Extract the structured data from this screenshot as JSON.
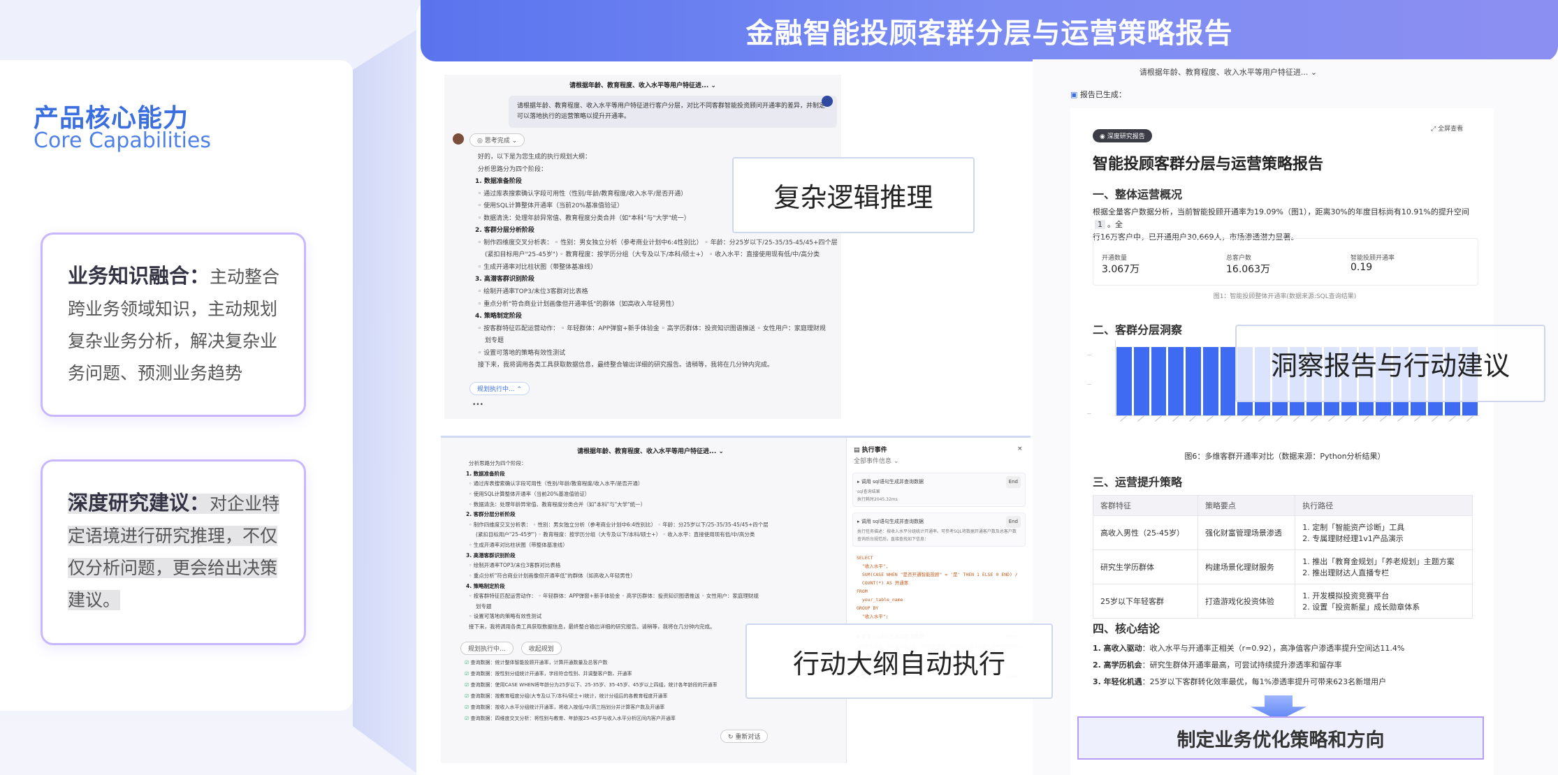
{
  "left": {
    "title": "产品核心能力",
    "subtitle": "Core Capabilities",
    "card1": {
      "heading": "业务知识融合：",
      "body": "主动整合跨业务领域知识，主动规划复杂业务分析，解决复杂业务问题、预测业务趋势"
    },
    "card2": {
      "heading": "深度研究建议：",
      "body": "对企业特定语境进行研究推理，不仅仅分析问题，更会给出决策建议。"
    }
  },
  "main_title": "金融智能投顾客群分层与运营策略报告",
  "callouts": {
    "reasoning": "复杂逻辑推理",
    "insight": "洞察报告与行动建议",
    "execution": "行动大纲自动执行",
    "bottom": "制定业务优化策略和方向"
  },
  "shot1": {
    "header": "请根据年龄、教育程度、收入水平等用户特征进...",
    "user_msg": "请根据年龄、教育程度、收入水平等用户特征进行客户分层，对比不同客群智能投资顾问开通率的差异，并制定可以落地执行的运营策略以提升开通率。",
    "thinking_pill": "思考完成",
    "lines": [
      {
        "t": "好的，以下是为您生成的执行规划大纲：",
        "s": "n"
      },
      {
        "t": "分析思路分为四个阶段：",
        "s": "n"
      },
      {
        "t": "1. 数据准备阶段",
        "s": "b"
      },
      {
        "t": "◦ 通过库表搜索确认字段可用性（性别/年龄/教育程度/收入水平/是否开通）",
        "s": "n"
      },
      {
        "t": "◦ 使用SQL计算整体开通率（当前20%基准值验证）",
        "s": "n"
      },
      {
        "t": "◦ 数据清洗：处理年龄异常值、教育程度分类合并（如\"本科\"与\"大学\"统一）",
        "s": "n"
      },
      {
        "t": "2. 客群分层分析阶段",
        "s": "b"
      },
      {
        "t": "◦ 制作四维度交叉分析表：  ◦ 性别：男女独立分析（参考商业计划中6:4性别比）  ◦ 年龄：分25岁以下/25-35/35-45/45+四个层",
        "s": "n"
      },
      {
        "t": "  (紧扣目标用户\"25-45岁\")  ◦ 教育程度：按学历分组（大专及以下/本科/硕士+）  ◦ 收入水平：直接使用现有低/中/高分类",
        "s": "n"
      },
      {
        "t": "◦ 生成开通率对比柱状图（带整体基准线）",
        "s": "n"
      },
      {
        "t": "3. 高潜客群识别阶段",
        "s": "b"
      },
      {
        "t": "◦ 绘制开通率TOP3/末位3客群对比表格",
        "s": "n"
      },
      {
        "t": "◦ 重点分析\"符合商业计划画像但开通率低\"的群体（如高收入年轻男性）",
        "s": "n"
      },
      {
        "t": "4. 策略制定阶段",
        "s": "b"
      },
      {
        "t": "◦ 按客群特征匹配运营动作：  ◦ 年轻群体：APP弹窗+新手体验金  ◦ 高学历群体：投资知识图谱推送  ◦ 女性用户：家庭理财规",
        "s": "n"
      },
      {
        "t": "  划专题",
        "s": "n"
      },
      {
        "t": "◦ 设置可落地的策略有效性测试",
        "s": "n"
      },
      {
        "t": "接下来，我将调用各类工具获取数据信息，最终整合输出详细的研究报告。请稍等，我将在几分钟内完成。",
        "s": "n"
      }
    ],
    "planning_pill": "规划执行中..."
  },
  "shot2": {
    "header": "请根据年龄、教育程度、收入水平等用户特征进...",
    "lines": [
      {
        "t": "分析思路分为四个阶段：",
        "s": "n"
      },
      {
        "t": "1. 数据准备阶段",
        "s": "b"
      },
      {
        "t": "◦ 通过库表搜索确认字段可用性（性别/年龄/教育程度/收入水平/是否开通）",
        "s": "n"
      },
      {
        "t": "◦ 使用SQL计算整体开通率（当前20%基准值验证）",
        "s": "n"
      },
      {
        "t": "◦ 数据清洗：处理年龄异常值、教育程度分类合并（如\"本科\"与\"大学\"统一）",
        "s": "n"
      },
      {
        "t": "2. 客群分层分析阶段",
        "s": "b"
      },
      {
        "t": "◦ 制作四维度交叉分析表：  ◦ 性别：男女独立分析（参考商业计划中6:4性别比）  ◦ 年龄：分25岁以下/25-35/35-45/45+四个层",
        "s": "n"
      },
      {
        "t": "  (紧扣目标用户\"25-45岁\")  ◦ 教育程度：按学历分组（大专及以下/本科/硕士+）  ◦ 收入水平：直接使用现有低/中/高分类",
        "s": "n"
      },
      {
        "t": "◦ 生成开通率对比柱状图（带整体基准线）",
        "s": "n"
      },
      {
        "t": "3. 高潜客群识别阶段",
        "s": "b"
      },
      {
        "t": "◦ 绘制开通率TOP3/末位3客群对比表格",
        "s": "n"
      },
      {
        "t": "◦ 重点分析\"符合商业计划画像但开通率低\"的群体（如高收入年轻男性）",
        "s": "n"
      },
      {
        "t": "4. 策略制定阶段",
        "s": "b"
      },
      {
        "t": "◦ 按客群特征匹配运营动作：  ◦ 年轻群体：APP弹窗+新手体验金  ◦ 高学历群体：投资知识图谱推送  ◦ 女性用户：家庭理财规",
        "s": "n"
      },
      {
        "t": "  划专题",
        "s": "n"
      },
      {
        "t": "◦ 设置可落地的策略有效性测试",
        "s": "n"
      },
      {
        "t": "接下来，我将调用各类工具获取数据信息，最终整合输出详细的研究报告。请稍等，我将在几分钟内完成。",
        "s": "n"
      }
    ],
    "pill_executing": "规划执行中...",
    "pill_collapse": "收起规划",
    "tasks": [
      "查询数据：统计整体智能投顾开通率，计算开通数量及总客户数",
      "查询数据：按性别分组统计开通率，字段符合性别、并调整客户数、开通率",
      "查询数据：使用CASE WHEN将年龄分为25岁以下、25-35岁、35-45岁、45岁以上四组，统计各年龄段的开通率",
      "查询数据：按教育程度分组(大专及以下/本科/硕士+)统计，统计分组后的各教育程度开通率",
      "查询数据：按收入水平分组统计开通率，将收入按低/中/高三档划分并计算客户数及开通率",
      "查询数据：四维度交叉分析：将性别与教育、年龄按25-45岁与收入水平分析区间内客户开通率"
    ],
    "retry": "重新对话",
    "events_title": "执行事件",
    "events_sub": "全部事件信息",
    "events": [
      {
        "label": "调用 sql语句生成并查询数据",
        "tag": "End",
        "a": "sql查询结果",
        "b": "执行耗时2045.32ms"
      },
      {
        "label": "调用 sql语句生成并查询数据",
        "tag": "End",
        "a": "执行任务描述：按收入水平分组统计开通率。可参考SQL将数据开通客户数及总客户数",
        "b": "查询后台规范后，直接查找如下信息："
      }
    ],
    "sql_lines": [
      "SELECT",
      "  \"收入水平\",",
      "  SUM(CASE WHEN \"是否开通智能投顾\" = '是' THEN 1 ELSE 0 END) /",
      "  COUNT(*) AS 开通率",
      "FROM",
      "  your_table_name",
      "GROUP BY",
      "  \"收入水平\";"
    ],
    "events_more": [
      {
        "label": "调用 sql语句生成并查询数据",
        "tag": "Start",
        "a": "执行任务描述：四维度交叉分析：将性别与教育、年龄按25-45岁与收入水平分析区间内客户开通率"
      },
      {
        "label": "调用 sql语句生成并查询数据",
        "tag": "Start"
      }
    ]
  },
  "shot3": {
    "header": "请根据年龄、教育程度、收入水平等用户特征进...",
    "generated": "报告已生成：",
    "tag": "深度研究报告",
    "fullscreen": "全屏查看",
    "title": "智能投顾客群分层与运营策略报告",
    "s1": "一、整体运营概况",
    "s1_text1": "根据全量客户数据分析，当前智能投顾开通率为19.09%（图1），距离30%的年度目标尚有10.91%的提升空间",
    "s1_ref": "1",
    "s1_text1b": "。全",
    "s1_text2": "行16万客户中，已开通用户30,669人，市场渗透潜力显著。",
    "stats": [
      {
        "label": "开通数量",
        "value": "3.067万"
      },
      {
        "label": "总客户数",
        "value": "16.063万"
      },
      {
        "label": "智能投顾开通率",
        "value": "0.19"
      }
    ],
    "fig1": "图1：智能投顾整体开通率(数据来源:SQL查询结果)",
    "s2": "二、客群分层洞察",
    "fig6": "图6：多维客群开通率对比（数据来源：Python分析结果）",
    "s3": "三、运营提升策略",
    "table_head": [
      "客群特征",
      "策略要点",
      "执行路径"
    ],
    "table_rows": [
      [
        "高收入男性（25-45岁）",
        "强化财富管理场景渗透",
        "1. 定制「智能资产诊断」工具",
        "2. 专属理财经理1v1产品演示"
      ],
      [
        "研究生学历群体",
        "构建场景化理财服务",
        "1. 推出「教育金规划」「养老规划」主题方案",
        "2. 推出理财达人直播专栏"
      ],
      [
        "25岁以下年轻客群",
        "打造游戏化投资体验",
        "1. 开发模拟投资竞赛平台",
        "2. 设置「投资新星」成长勋章体系"
      ]
    ],
    "s4": "四、核心结论",
    "c1_b": "1. 高收入驱动",
    "c1": "：收入水平与开通率正相关（r=0.92），高净值客户渗透率提升空间达11.4%",
    "c2_b": "2. 高学历机会",
    "c2": "：研究生群体开通率最高，可尝试持续提升渗透率和留存率",
    "c3_b": "3. 年轻化机遇",
    "c3": "：25岁以下客群转化效率最优，每1%渗透率提升可带来623名新增用户"
  },
  "chart_data": {
    "type": "bar",
    "title": "",
    "xlabel": "",
    "ylabel": "",
    "values": [
      0.35,
      0.35,
      0.35,
      0.35,
      0.35,
      0.35,
      0.35,
      0.35,
      0.35,
      0.35,
      0.35,
      0.35,
      0.35,
      0.35,
      0.35,
      0.35,
      0.35,
      0.35,
      0.35,
      0.35,
      0.35
    ],
    "ylim": [
      0,
      0.35
    ],
    "bar_color": "#3f6af2"
  },
  "colors": {
    "accent": "#5a74ee",
    "card_border": "#c8b6ff",
    "bar": "#3f6af2"
  }
}
